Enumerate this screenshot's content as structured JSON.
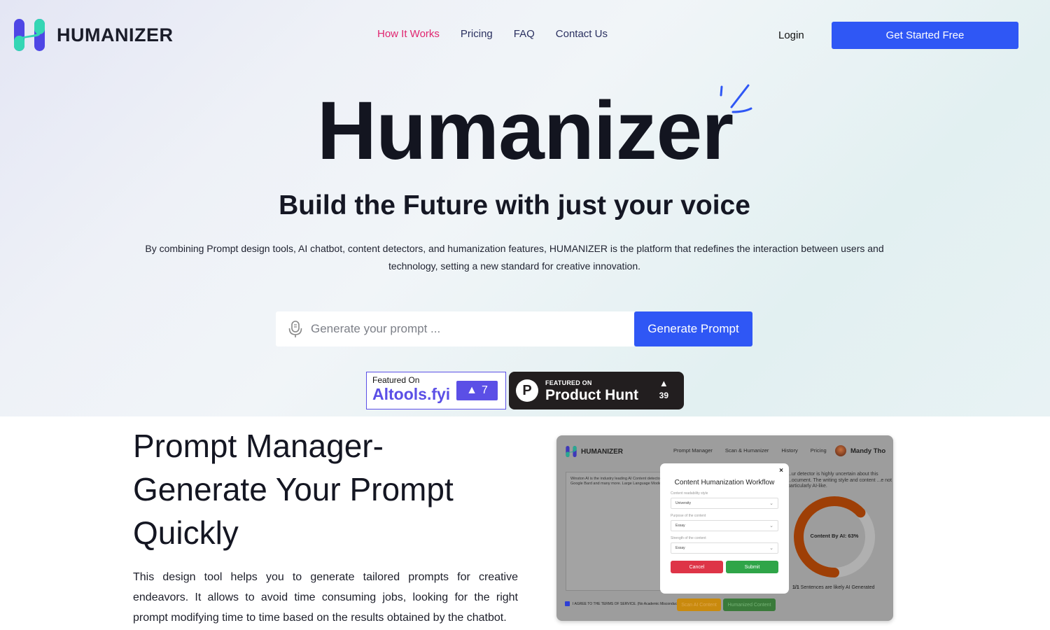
{
  "brand": {
    "name": "HUMANIZER",
    "accent": "#2f57f5",
    "active_nav": "#e0256f"
  },
  "nav": {
    "items": [
      {
        "label": "How It Works",
        "active": true
      },
      {
        "label": "Pricing",
        "active": false
      },
      {
        "label": "FAQ",
        "active": false
      },
      {
        "label": "Contact Us",
        "active": false
      }
    ],
    "login_label": "Login",
    "cta_label": "Get Started Free"
  },
  "hero": {
    "title": "Humanizer",
    "subtitle": "Build the Future with just your voice",
    "description": "By combining Prompt design tools, AI chatbot, content detectors, and humanization features, HUMANIZER is the platform that redefines the interaction between users and technology, setting a new standard for creative innovation."
  },
  "prompt": {
    "placeholder": "Generate your prompt ...",
    "value": "",
    "button_label": "Generate Prompt",
    "icon": "microphone-icon"
  },
  "badges": {
    "aitools": {
      "featured": "Featured On",
      "name": "Altools.fyi",
      "count": "7"
    },
    "producthunt": {
      "featured": "FEATURED ON",
      "name": "Product Hunt",
      "votes": "39",
      "logo_letter": "P"
    }
  },
  "section": {
    "title": "Prompt Manager- Generate Your Prompt Quickly",
    "body": "This design tool helps you to generate tailored prompts for creative endeavors. It allows to avoid time consuming jobs, looking for the right prompt modifying time to time based on the results obtained by the chatbot."
  },
  "mock": {
    "brand": "HUMANIZER",
    "nav": [
      "Prompt Manager",
      "Scan & Humanizer",
      "History",
      "Pricing"
    ],
    "user_name": "Mandy Tho",
    "textarea_text": "Winston AI is the industry leading AI Content detector... Google Bard and many more. Large Language Models...",
    "detector_text": "...ur detector is highly uncertain about this ...ocument. The writing style and content ...e not particularly AI-like.",
    "ai_percent": 63,
    "donut_label": "Content By AI: 63%",
    "sentences_bold": "1/1",
    "sentences_text": " Sentences are likely AI Generated",
    "agree_text": "I AGREE TO THE TERMS OF SERVICE. (No Academic Misconduct)",
    "scan_button": "Scan AI Content",
    "humanize_button": "Humanized Content",
    "modal": {
      "title": "Content Humanization Workflow",
      "close": "×",
      "fields": [
        {
          "label": "Content readability style",
          "value": "University"
        },
        {
          "label": "Purpose of the content",
          "value": "Essay"
        },
        {
          "label": "Strength of the content",
          "value": "Essay"
        }
      ],
      "cancel_label": "Cancel",
      "submit_label": "Submit"
    }
  }
}
